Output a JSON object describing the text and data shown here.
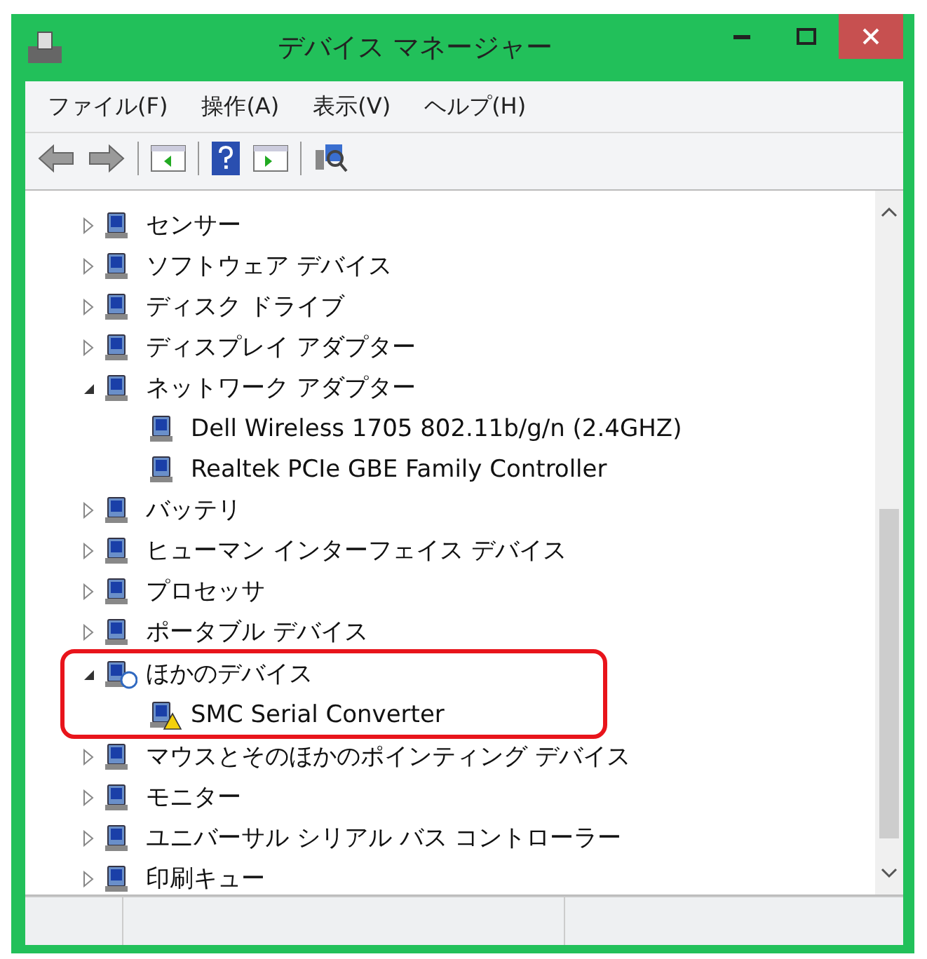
{
  "window": {
    "title": "デバイス マネージャー"
  },
  "menu": [
    "ファイル(F)",
    "操作(A)",
    "表示(V)",
    "ヘルプ(H)"
  ],
  "tree": [
    {
      "label": "センサー",
      "expanded": false
    },
    {
      "label": "ソフトウェア デバイス",
      "expanded": false
    },
    {
      "label": "ディスク ドライブ",
      "expanded": false
    },
    {
      "label": "ディスプレイ アダプター",
      "expanded": false
    },
    {
      "label": "ネットワーク アダプター",
      "expanded": true,
      "children": [
        {
          "label": "Dell Wireless 1705 802.11b/g/n (2.4GHZ)",
          "warning": false
        },
        {
          "label": "Realtek PCIe GBE Family Controller",
          "warning": false
        }
      ]
    },
    {
      "label": "バッテリ",
      "expanded": false
    },
    {
      "label": "ヒューマン インターフェイス デバイス",
      "expanded": false
    },
    {
      "label": "プロセッサ",
      "expanded": false
    },
    {
      "label": "ポータブル デバイス",
      "expanded": false
    },
    {
      "label": "ほかのデバイス",
      "expanded": true,
      "highlighted": true,
      "children": [
        {
          "label": "SMC Serial Converter",
          "warning": true
        }
      ]
    },
    {
      "label": "マウスとそのほかのポインティング デバイス",
      "expanded": false
    },
    {
      "label": "モニター",
      "expanded": false
    },
    {
      "label": "ユニバーサル シリアル バス コントローラー",
      "expanded": false
    },
    {
      "label": "印刷キュー",
      "expanded": false
    }
  ]
}
